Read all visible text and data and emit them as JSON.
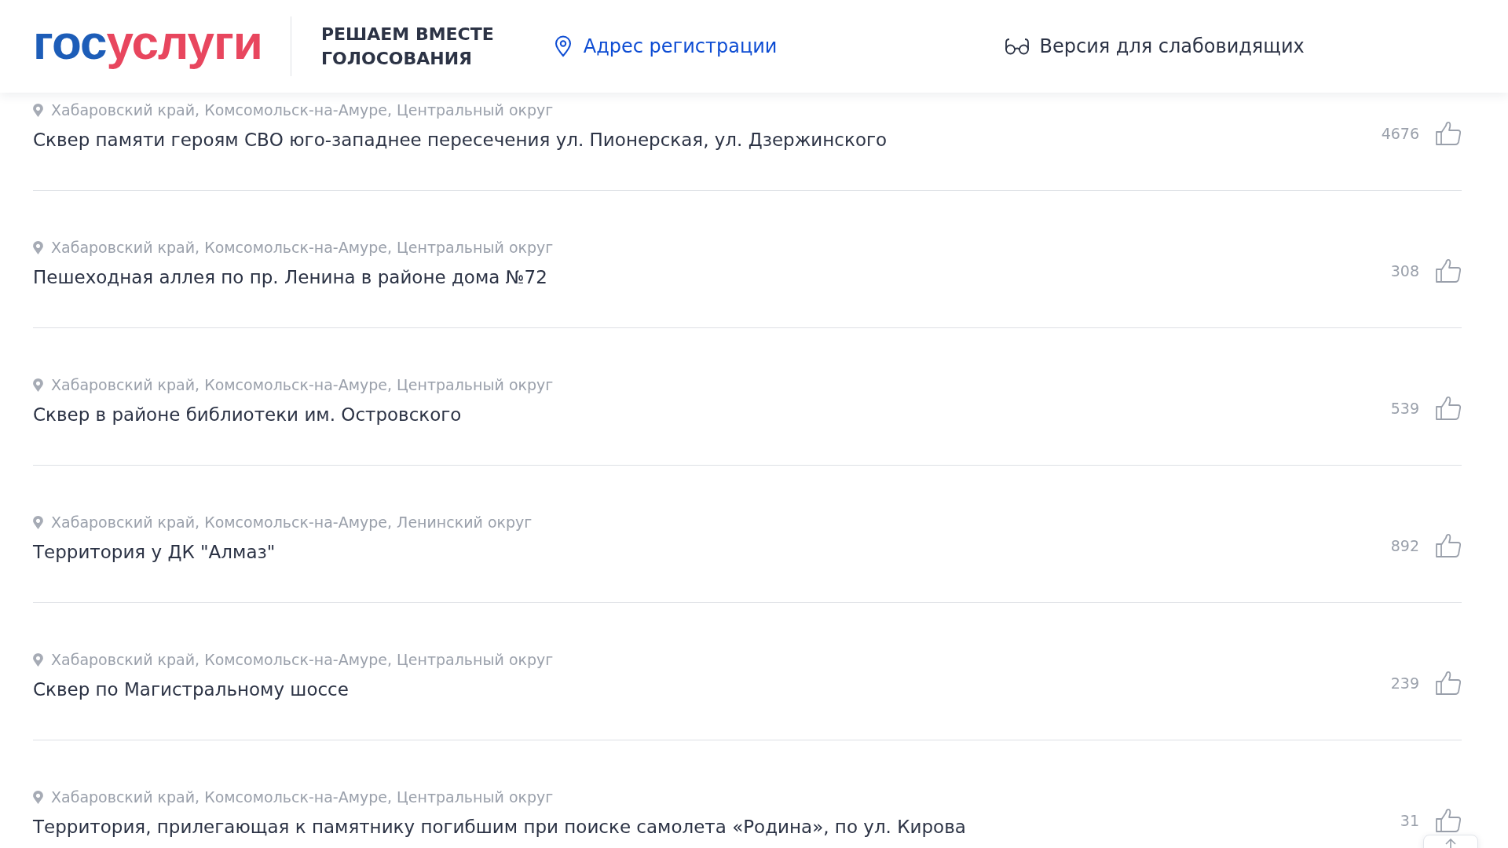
{
  "header": {
    "logo": {
      "part_1": "гос",
      "part_2": "услуги"
    },
    "tagline": [
      "РЕШАЕМ ВМЕСТЕ",
      "ГОЛОСОВАНИЯ"
    ],
    "address_link": "Адрес регистрации",
    "accessibility_link": "Версия для слабовидящих"
  },
  "items": [
    {
      "location": "Хабаровский край, Комсомольск-на-Амуре, Центральный округ",
      "title": "Сквер памяти героям СВО юго-западнее пересечения ул. Пионерская, ул. Дзержинского",
      "votes": "4676"
    },
    {
      "location": "Хабаровский край, Комсомольск-на-Амуре, Центральный округ",
      "title": "Пешеходная аллея по пр. Ленина в районе дома №72",
      "votes": "308"
    },
    {
      "location": "Хабаровский край, Комсомольск-на-Амуре, Центральный округ",
      "title": "Сквер в районе библиотеки им. Островского",
      "votes": "539"
    },
    {
      "location": "Хабаровский край, Комсомольск-на-Амуре, Ленинский округ",
      "title": "Территория у ДК \"Алмаз\"",
      "votes": "892"
    },
    {
      "location": "Хабаровский край, Комсомольск-на-Амуре, Центральный округ",
      "title": "Сквер по Магистральному шоссе",
      "votes": "239"
    },
    {
      "location": "Хабаровский край, Комсомольск-на-Амуре, Центральный округ",
      "title": "Территория, прилегающая к памятнику погибшим при поиске самолета «Родина», по ул. Кирова",
      "votes": "31"
    }
  ]
}
